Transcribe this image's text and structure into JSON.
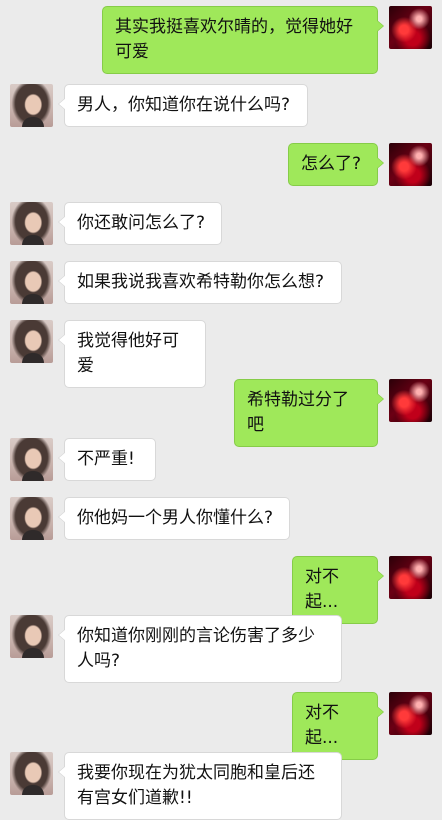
{
  "messages": [
    {
      "side": "right",
      "text": "其实我挺喜欢尔晴的，觉得她好可爱"
    },
    {
      "side": "left",
      "text": "男人，你知道你在说什么吗?"
    },
    {
      "side": "right",
      "text": "怎么了?"
    },
    {
      "side": "left",
      "text": "你还敢问怎么了?"
    },
    {
      "side": "left",
      "text": "如果我说我喜欢希特勒你怎么想?"
    },
    {
      "side": "left",
      "text": "我觉得他好可爱"
    },
    {
      "side": "right",
      "text": "希特勒过分了吧"
    },
    {
      "side": "left",
      "text": "不严重!"
    },
    {
      "side": "left",
      "text": "你他妈一个男人你懂什么?"
    },
    {
      "side": "right",
      "text": "对不起..."
    },
    {
      "side": "left",
      "text": "你知道你刚刚的言论伤害了多少人吗?"
    },
    {
      "side": "right",
      "text": "对不起..."
    },
    {
      "side": "left",
      "text": "我要你现在为犹太同胞和皇后还有宫女们道歉!!"
    }
  ]
}
